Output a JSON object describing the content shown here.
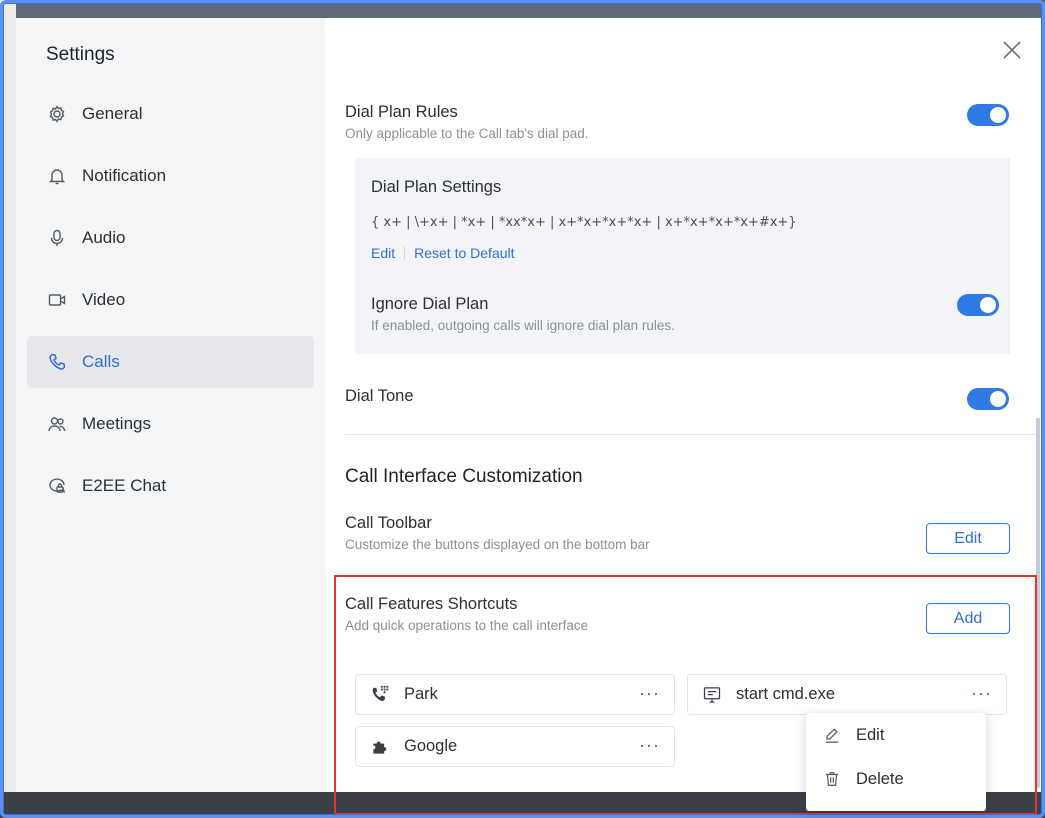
{
  "sidebar": {
    "title": "Settings",
    "items": [
      {
        "label": "General",
        "icon": "gear-icon"
      },
      {
        "label": "Notification",
        "icon": "bell-icon"
      },
      {
        "label": "Audio",
        "icon": "microphone-icon"
      },
      {
        "label": "Video",
        "icon": "video-camera-icon"
      },
      {
        "label": "Calls",
        "icon": "phone-icon",
        "active": true
      },
      {
        "label": "Meetings",
        "icon": "people-icon"
      },
      {
        "label": "E2EE Chat",
        "icon": "secure-chat-icon"
      }
    ]
  },
  "main": {
    "dial_plan_rules": {
      "label": "Dial Plan Rules",
      "description": "Only applicable to the Call tab's dial pad.",
      "enabled": true
    },
    "dial_plan_settings": {
      "label": "Dial Plan Settings",
      "value": "{ x+ | \\+x+ | *x+ | *xx*x+ | x+*x+*x+*x+ | x+*x+*x+*x+#x+}",
      "edit_label": "Edit",
      "reset_label": "Reset to Default"
    },
    "ignore_dial_plan": {
      "label": "Ignore Dial Plan",
      "description": "If enabled, outgoing calls will ignore dial plan rules.",
      "enabled": true
    },
    "dial_tone": {
      "label": "Dial Tone",
      "enabled": true
    },
    "customization": {
      "title": "Call Interface Customization",
      "toolbar": {
        "label": "Call Toolbar",
        "description": "Customize the buttons displayed on the bottom bar",
        "button": "Edit"
      },
      "shortcuts": {
        "label": "Call Features Shortcuts",
        "description": "Add quick operations to the call interface",
        "button": "Add",
        "items": [
          {
            "label": "Park",
            "icon": "phone-keypad-icon",
            "more": "···"
          },
          {
            "label": "start cmd.exe",
            "icon": "monitor-icon",
            "more": "···"
          },
          {
            "label": "Google",
            "icon": "puzzle-icon",
            "more": "···"
          }
        ]
      }
    },
    "context_menu": {
      "items": [
        {
          "label": "Edit",
          "icon": "pencil-icon"
        },
        {
          "label": "Delete",
          "icon": "trash-icon"
        }
      ]
    }
  },
  "colors": {
    "accent": "#2f7ae5",
    "highlight_border": "#e5332f",
    "sidebar_bg": "#f4f5f7"
  }
}
